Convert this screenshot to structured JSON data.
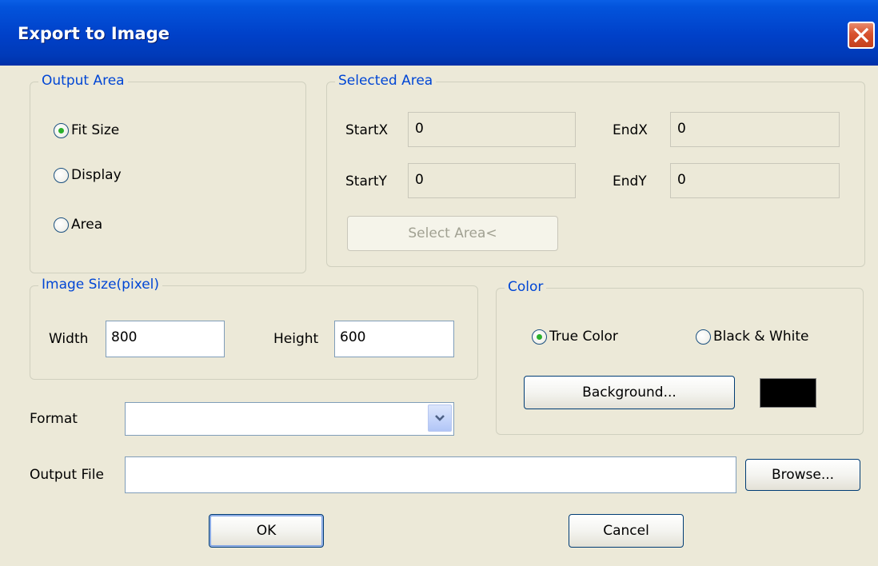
{
  "window": {
    "title": "Export to Image"
  },
  "output_area": {
    "legend": "Output Area",
    "options": [
      {
        "label": "Fit Size",
        "checked": true
      },
      {
        "label": "Display",
        "checked": false
      },
      {
        "label": "Area",
        "checked": false
      }
    ]
  },
  "selected_area": {
    "legend": "Selected Area",
    "startx_label": "StartX",
    "startx_value": "0",
    "endx_label": "EndX",
    "endx_value": "0",
    "starty_label": "StartY",
    "starty_value": "0",
    "endy_label": "EndY",
    "endy_value": "0",
    "select_button": "Select Area<"
  },
  "image_size": {
    "legend": "Image Size(pixel)",
    "width_label": "Width",
    "width_value": "800",
    "height_label": "Height",
    "height_value": "600"
  },
  "color": {
    "legend": "Color",
    "true_color_label": "True Color",
    "true_color_checked": true,
    "bw_label": "Black & White",
    "bw_checked": false,
    "background_button": "Background...",
    "background_color": "#000000"
  },
  "format": {
    "label": "Format",
    "value": ""
  },
  "output_file": {
    "label": "Output File",
    "value": "",
    "browse_button": "Browse..."
  },
  "buttons": {
    "ok": "OK",
    "cancel": "Cancel"
  }
}
